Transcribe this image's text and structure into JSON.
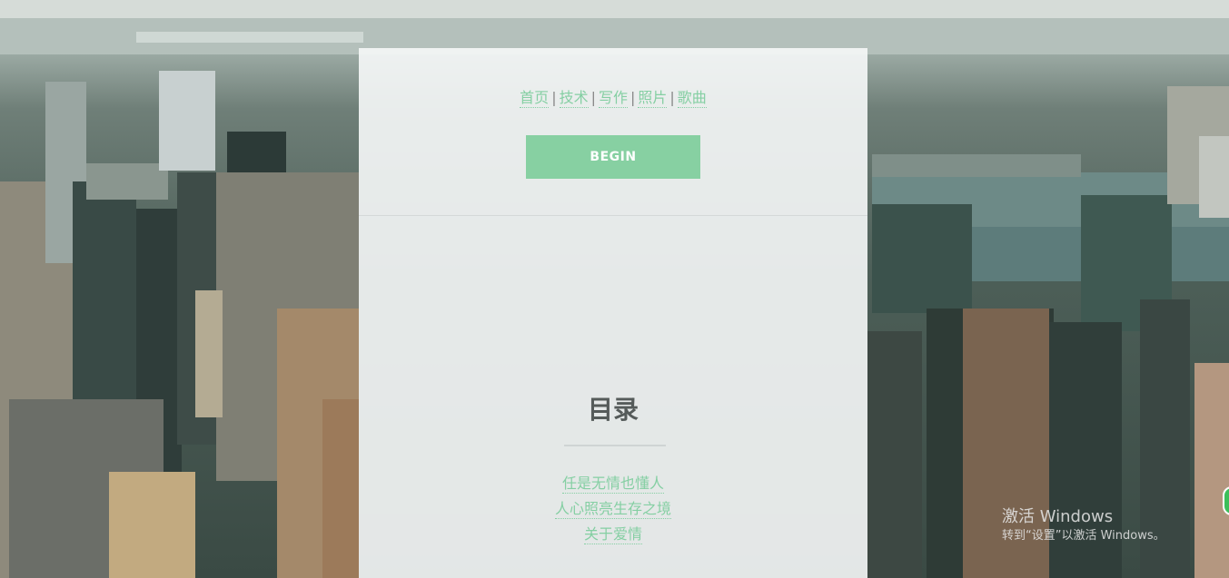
{
  "nav": {
    "items": [
      {
        "label": "首页"
      },
      {
        "label": "技术"
      },
      {
        "label": "写作"
      },
      {
        "label": "照片"
      },
      {
        "label": "歌曲"
      }
    ],
    "separator": "|"
  },
  "hero": {
    "begin_label": "BEGIN"
  },
  "toc": {
    "title": "目录",
    "items": [
      {
        "label": "任是无情也懂人"
      },
      {
        "label": "人心照亮生存之境"
      },
      {
        "label": "关于爱情"
      }
    ]
  },
  "watermark": {
    "line1": "激活 Windows",
    "line2": "转到“设置”以激活 Windows。"
  },
  "colors": {
    "accent": "#87d0a2",
    "title": "#555b5a"
  }
}
